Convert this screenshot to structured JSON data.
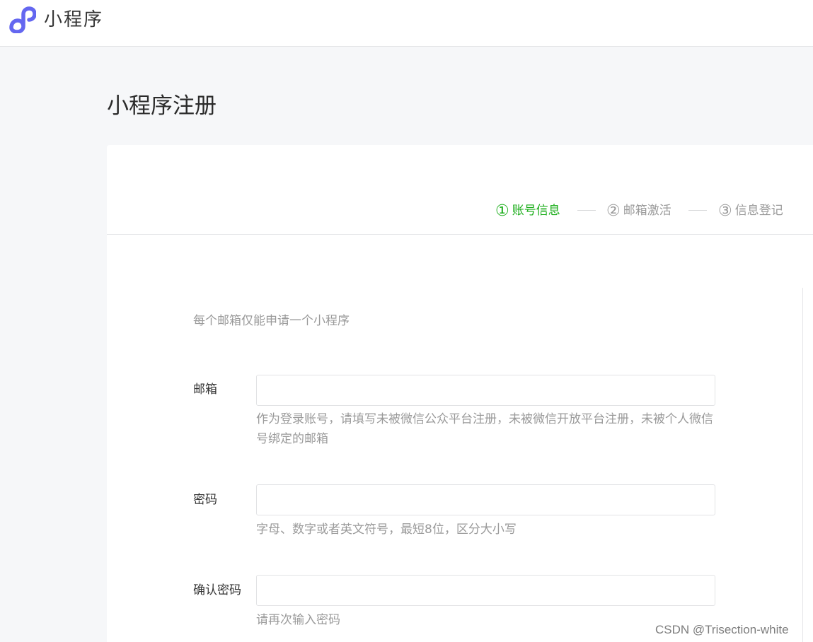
{
  "header": {
    "brand": "小程序",
    "logo_icon": "miniprogram-logo-icon",
    "logo_color": "#6467f0"
  },
  "page": {
    "title": "小程序注册"
  },
  "steps": [
    {
      "num": "①",
      "label": "账号信息",
      "active": true
    },
    {
      "num": "②",
      "label": "邮箱激活",
      "active": false
    },
    {
      "num": "③",
      "label": "信息登记",
      "active": false
    }
  ],
  "form": {
    "notice": "每个邮箱仅能申请一个小程序",
    "email": {
      "label": "邮箱",
      "value": "",
      "hint": "作为登录账号，请填写未被微信公众平台注册，未被微信开放平台注册，未被个人微信号绑定的邮箱"
    },
    "password": {
      "label": "密码",
      "value": "",
      "hint": "字母、数字或者英文符号，最短8位，区分大小写"
    },
    "confirm": {
      "label": "确认密码",
      "value": "",
      "hint": "请再次输入密码"
    }
  },
  "colors": {
    "active_step": "#1aad19",
    "muted_text": "#9a9a9a",
    "background": "#f6f7f9"
  },
  "watermark": "CSDN @Trisection-white"
}
